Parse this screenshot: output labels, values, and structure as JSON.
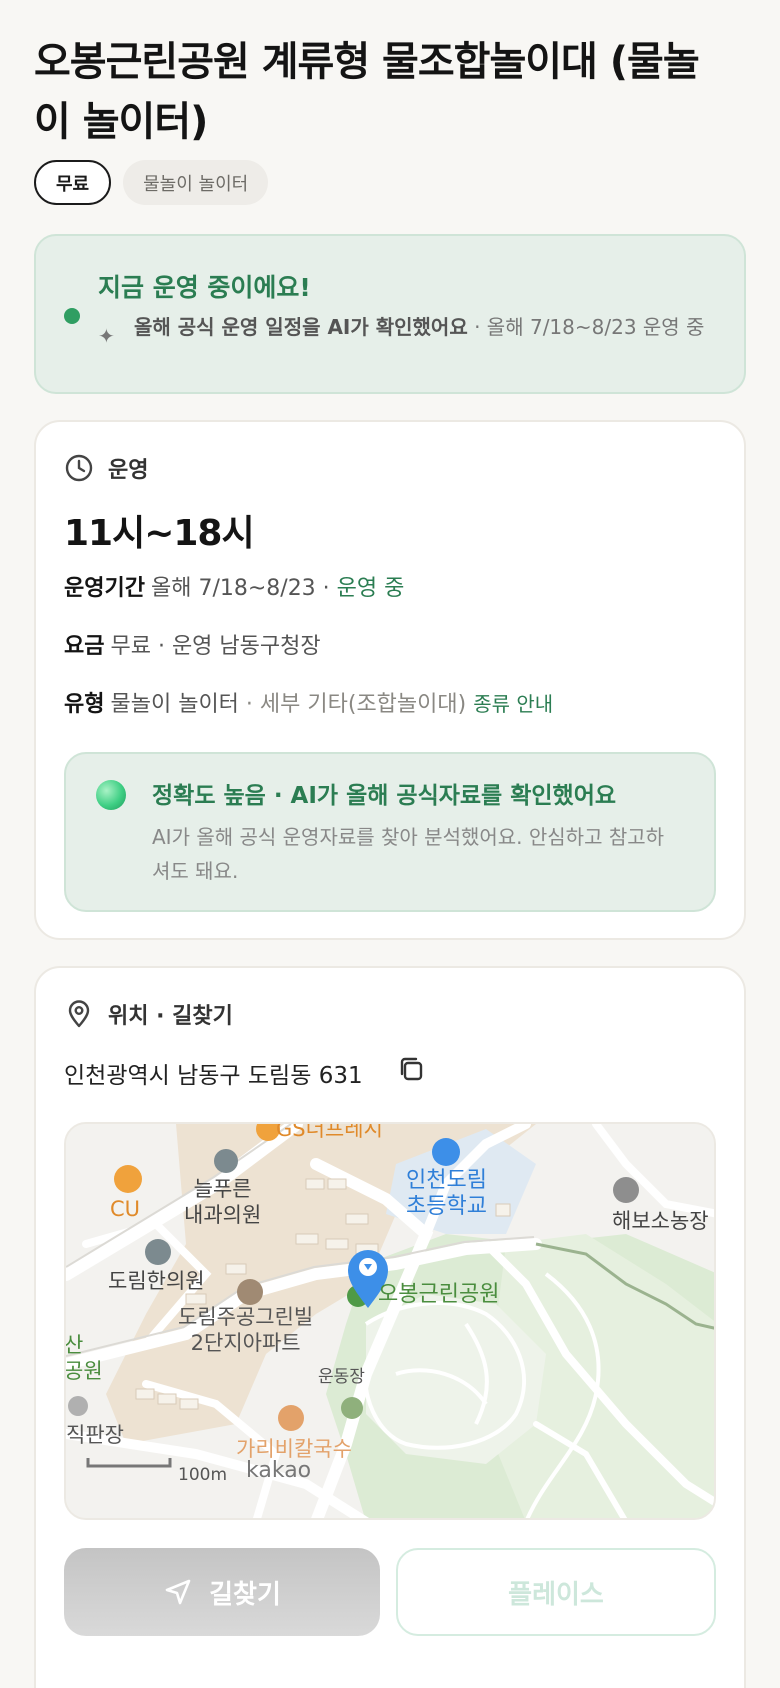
{
  "title": "오봉근린공원 계류형 물조합놀이대 (물놀이 놀이터)",
  "tags": {
    "free": "무료",
    "type": "물놀이 놀이터"
  },
  "status": {
    "headline": "지금 운영 중이에요!",
    "sub_bold": "올해 공식 운영 일정을 AI가 확인했어요",
    "sub_rest": " · 올해 7/18~8/23 운영 중"
  },
  "hours": {
    "section": "운영",
    "time": "11시~18시",
    "period_key": "운영기간",
    "period_val": "올해 7/18~8/23 · ",
    "period_status": "운영 중",
    "fee_key": "요금",
    "fee_val": "무료 · 운영 남동구청장",
    "type_key": "유형",
    "type_val": "물놀이 놀이터",
    "type_detail": " · 세부 기타(조합놀이대) ",
    "type_link": "종류 안내"
  },
  "accuracy": {
    "title": "정확도 높음 · AI가 올해 공식자료를 확인했어요",
    "desc": "AI가 올해 공식 운영자료를 찾아 분석했어요. 안심하고 참고하셔도 돼요."
  },
  "location": {
    "section": "위치 · 길찾기",
    "address": "인천광역시 남동구 도림동 631"
  },
  "map": {
    "labels": {
      "gs": "GS더프레시",
      "cu": "CU",
      "clinic1": "늘푸른\n내과의원",
      "school": "인천도림\n초등학교",
      "haebo": "해보소농장",
      "clinic2": "도림한의원",
      "apt": "도림주공그린빌\n2단지아파트",
      "park": "오봉근린공원",
      "left_park": "산\n공원",
      "field": "운동장",
      "market": "직판장",
      "noodle": "가리비칼국수",
      "scale": "100m",
      "brand": "kakao"
    }
  },
  "buttons": {
    "directions": "길찾기",
    "place": "플레이스"
  },
  "colors": {
    "accent_green": "#2b7d52",
    "pin_blue": "#3d8fe8"
  }
}
